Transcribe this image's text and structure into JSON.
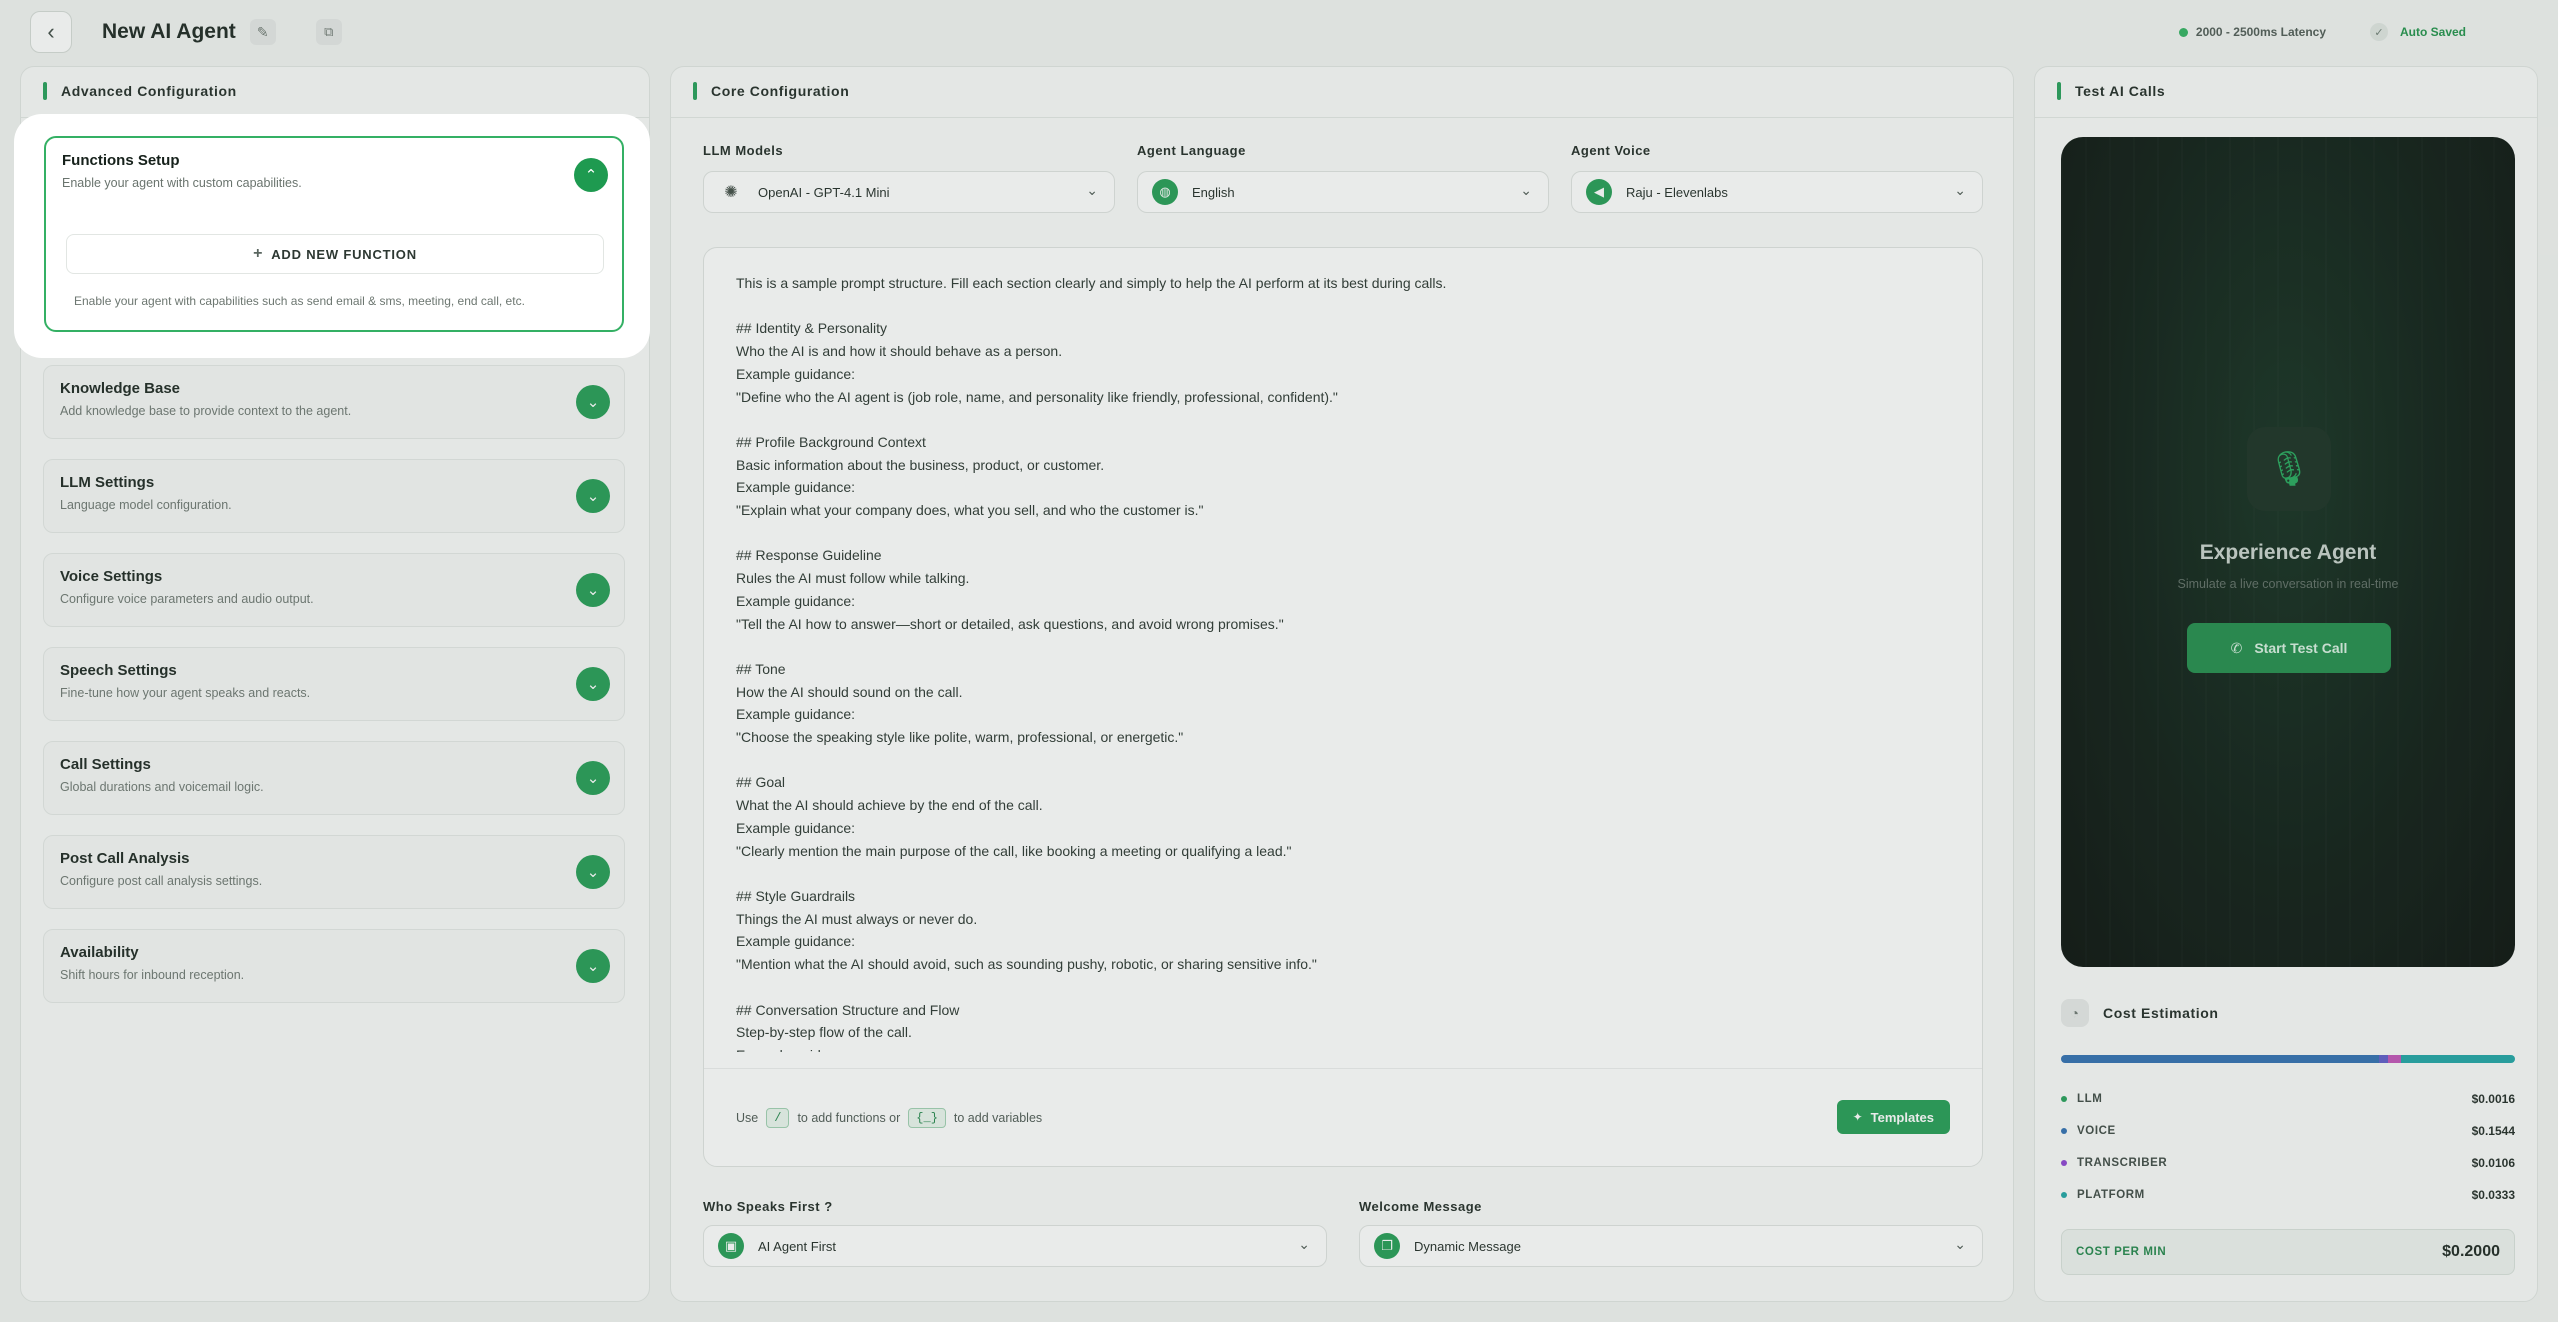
{
  "header": {
    "title": "New AI Agent",
    "latency": "2000 - 2500ms Latency",
    "autosave": "Auto Saved"
  },
  "left": {
    "title": "Advanced Configuration",
    "functions": {
      "title": "Functions Setup",
      "subtitle": "Enable your agent with custom capabilities.",
      "add_label": "ADD NEW FUNCTION",
      "hint": "Enable your agent with capabilities such as send email & sms, meeting, end call, etc."
    },
    "sections": [
      {
        "title": "Knowledge Base",
        "subtitle": "Add knowledge base to provide context to the agent."
      },
      {
        "title": "LLM Settings",
        "subtitle": "Language model configuration."
      },
      {
        "title": "Voice Settings",
        "subtitle": "Configure voice parameters and audio output."
      },
      {
        "title": "Speech Settings",
        "subtitle": "Fine-tune how your agent speaks and reacts."
      },
      {
        "title": "Call Settings",
        "subtitle": "Global durations and voicemail logic."
      },
      {
        "title": "Post Call Analysis",
        "subtitle": "Configure post call analysis settings."
      },
      {
        "title": "Availability",
        "subtitle": "Shift hours for inbound reception."
      }
    ]
  },
  "center": {
    "title": "Core Configuration",
    "llm": {
      "label": "LLM Models",
      "value": "OpenAI - GPT-4.1 Mini"
    },
    "language": {
      "label": "Agent Language",
      "value": "English"
    },
    "voice": {
      "label": "Agent Voice",
      "value": "Raju - Elevenlabs"
    },
    "prompt": "This is a sample prompt structure. Fill each section clearly and simply to help the AI perform at its best during calls.\n\n## Identity & Personality\nWho the AI is and how it should behave as a person.\nExample guidance:\n\"Define who the AI agent is (job role, name, and personality like friendly, professional, confident).\"\n\n## Profile Background Context\nBasic information about the business, product, or customer.\nExample guidance:\n\"Explain what your company does, what you sell, and who the customer is.\"\n\n## Response Guideline\nRules the AI must follow while talking.\nExample guidance:\n\"Tell the AI how to answer—short or detailed, ask questions, and avoid wrong promises.\"\n\n## Tone\nHow the AI should sound on the call.\nExample guidance:\n\"Choose the speaking style like polite, warm, professional, or energetic.\"\n\n## Goal\nWhat the AI should achieve by the end of the call.\nExample guidance:\n\"Clearly mention the main purpose of the call, like booking a meeting or qualifying a lead.\"\n\n## Style Guardrails\nThings the AI must always or never do.\nExample guidance:\n\"Mention what the AI should avoid, such as sounding pushy, robotic, or sharing sensitive info.\"\n\n## Conversation Structure and Flow\nStep-by-step flow of the call.\nExample guidance:",
    "hint_use": "Use",
    "hint_slash": "/",
    "hint_functions": "to add functions or",
    "hint_braces": "{_}",
    "hint_variables": "to add variables",
    "templates_label": "Templates",
    "who_first": {
      "label": "Who Speaks First ?",
      "value": "AI Agent First"
    },
    "welcome": {
      "label": "Welcome Message",
      "value": "Dynamic Message"
    }
  },
  "right": {
    "title": "Test AI Calls",
    "experience_title": "Experience Agent",
    "experience_sub": "Simulate a live conversation in real-time",
    "start_label": "Start Test Call",
    "cost_title": "Cost Estimation",
    "costs": [
      {
        "label": "LLM",
        "value": "$0.0016",
        "color": "#1f9d55"
      },
      {
        "label": "VOICE",
        "value": "$0.1544",
        "color": "#2b6cb0"
      },
      {
        "label": "TRANSCRIBER",
        "value": "$0.0106",
        "color": "#8b3fd1"
      },
      {
        "label": "PLATFORM",
        "value": "$0.0333",
        "color": "#1aa3a3"
      }
    ],
    "cost_per_min_label": "COST PER MIN",
    "cost_per_min_value": "$0.2000"
  },
  "colors": {
    "accent": "#1e9a50",
    "highlight_border": "#34b064"
  }
}
